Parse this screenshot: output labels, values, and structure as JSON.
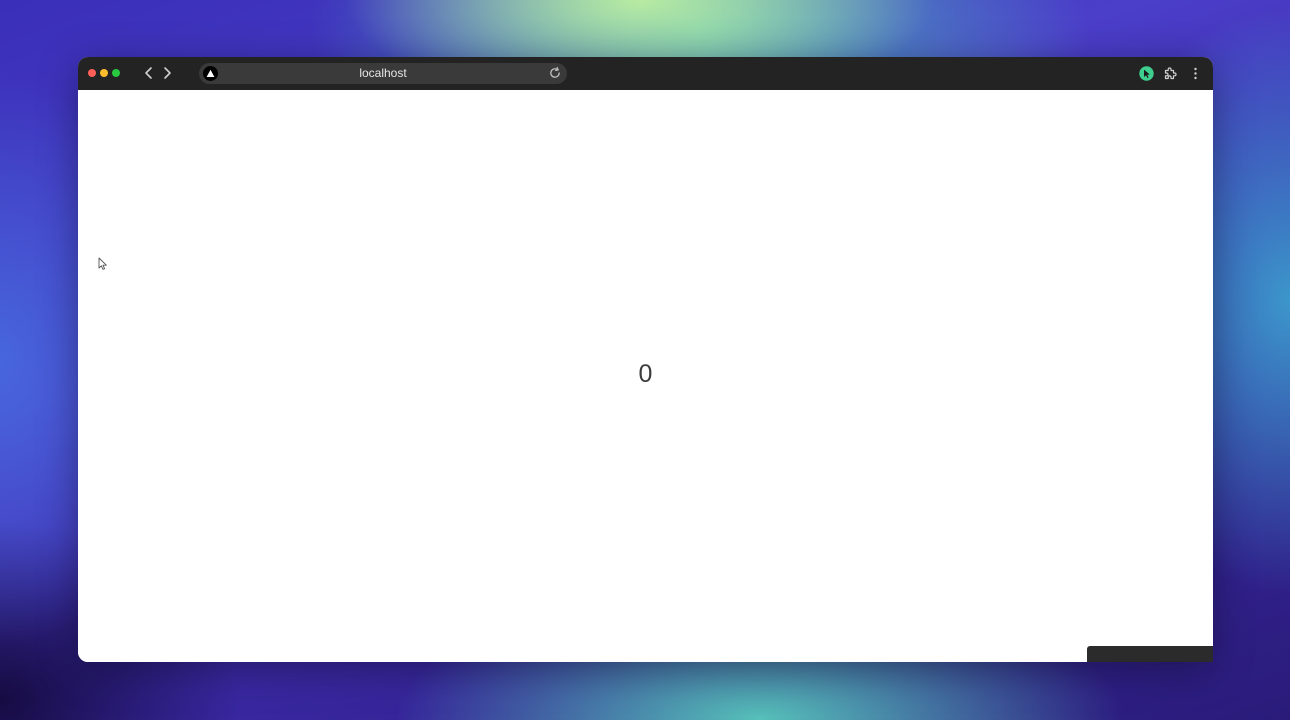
{
  "browser": {
    "url": "localhost"
  },
  "page": {
    "counter_value": "0"
  },
  "icons": {
    "back": "chevron-left-icon",
    "forward": "chevron-right-icon",
    "site": "triangle-logo-icon",
    "reload": "reload-icon",
    "extension_cursor": "cursor-extension-icon",
    "extensions": "puzzle-icon",
    "menu": "more-vertical-icon"
  },
  "colors": {
    "toolbar": "#232323",
    "omnibox": "#3a3a3a",
    "close": "#ff5f57",
    "minimize": "#febc2e",
    "maximize": "#28c840",
    "extension_accent": "#3ecf8e"
  }
}
